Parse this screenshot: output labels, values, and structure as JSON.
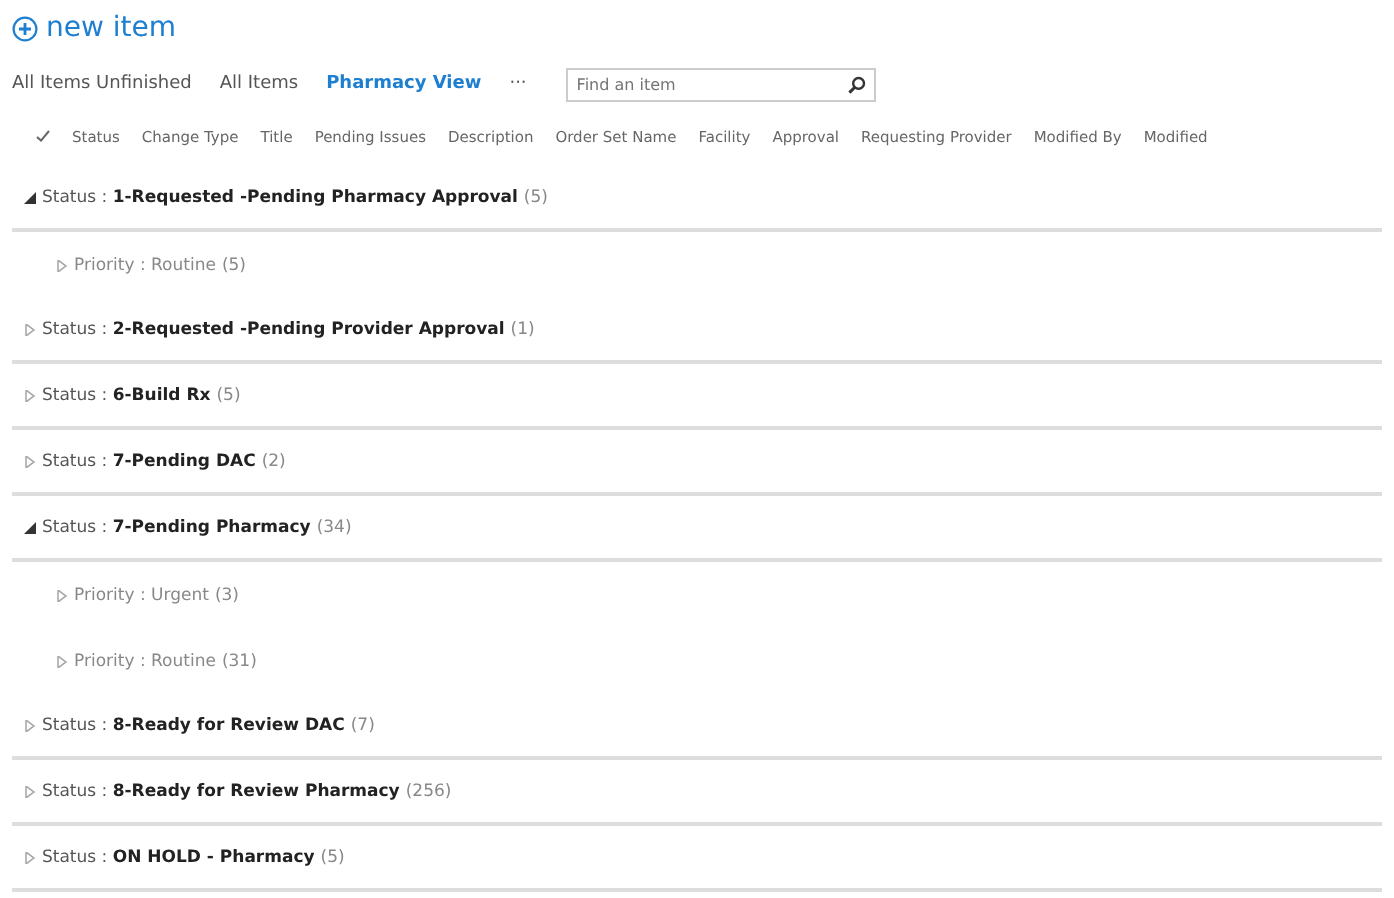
{
  "new_item": {
    "label": "new item"
  },
  "views": [
    {
      "label": "All Items Unfinished",
      "selected": false
    },
    {
      "label": "All Items",
      "selected": false
    },
    {
      "label": "Pharmacy View",
      "selected": true
    }
  ],
  "more_views": "···",
  "search": {
    "placeholder": "Find an item"
  },
  "columns": [
    "Status",
    "Change Type",
    "Title",
    "Pending Issues",
    "Description",
    "Order Set Name",
    "Facility",
    "Approval",
    "Requesting Provider",
    "Modified By",
    "Modified"
  ],
  "groups": [
    {
      "label": "Status : **1-Requested -Pending Pharmacy Approval**",
      "count": "(5)",
      "expanded": true,
      "children": [
        {
          "label": "Priority : Routine",
          "count": "(5)",
          "expanded": false
        }
      ]
    },
    {
      "label": "Status : **2-Requested -Pending Provider Approval**",
      "count": "(1)",
      "expanded": false
    },
    {
      "label": "Status : **6-Build Rx**",
      "count": "(5)",
      "expanded": false
    },
    {
      "label": "Status : **7-Pending DAC**",
      "count": "(2)",
      "expanded": false
    },
    {
      "label": "Status : **7-Pending Pharmacy**",
      "count": "(34)",
      "expanded": true,
      "children": [
        {
          "label": "Priority : Urgent",
          "count": "(3)",
          "expanded": false
        },
        {
          "label": "Priority : Routine",
          "count": "(31)",
          "expanded": false
        }
      ]
    },
    {
      "label": "Status : **8-Ready for Review DAC**",
      "count": "(7)",
      "expanded": false
    },
    {
      "label": "Status : **8-Ready for Review Pharmacy**",
      "count": "(256)",
      "expanded": false
    },
    {
      "label": "Status : **ON HOLD - Pharmacy**",
      "count": "(5)",
      "expanded": false
    }
  ]
}
